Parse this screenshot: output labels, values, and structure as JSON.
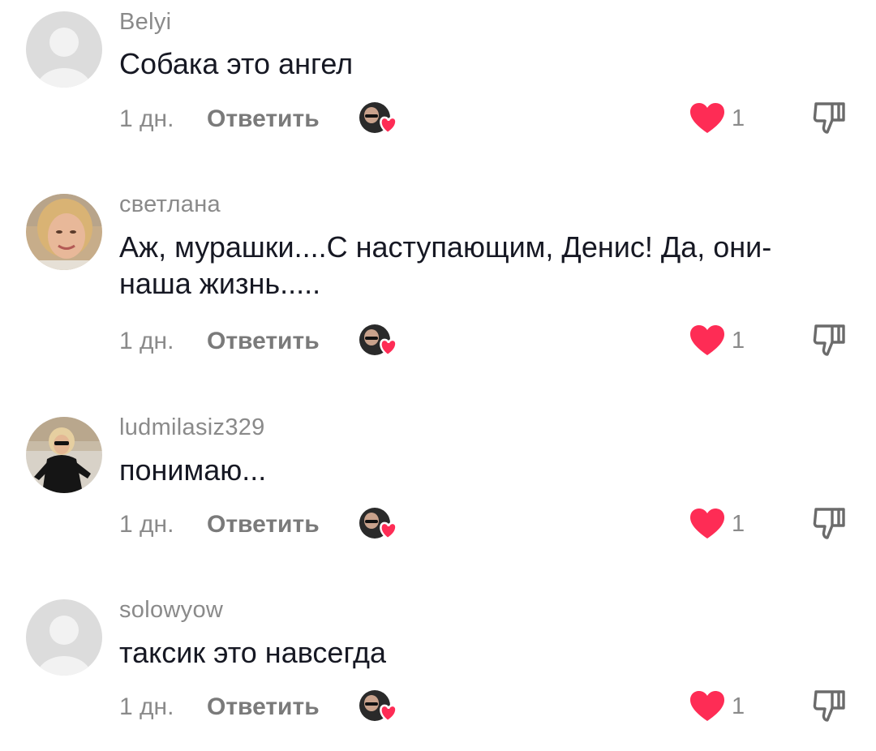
{
  "comments": [
    {
      "username": "Belyi",
      "text": "Собака это ангел",
      "time": "1 дн.",
      "reply_label": "Ответить",
      "likes": "1",
      "avatar": "default-avatar"
    },
    {
      "username": "светлана",
      "text": "Аж, мурашки....С наступающим, Денис! Да, они-\nнаша жизнь.....",
      "time": "1 дн.",
      "reply_label": "Ответить",
      "likes": "1",
      "avatar": "photo-woman-blonde"
    },
    {
      "username": "ludmilasiz329",
      "text": "понимаю...",
      "time": "1 дн.",
      "reply_label": "Ответить",
      "likes": "1",
      "avatar": "photo-woman-black-dress"
    },
    {
      "username": "solowyow",
      "text": "таксик это навсегда",
      "time": "1 дн.",
      "reply_label": "Ответить",
      "likes": "1",
      "avatar": "default-avatar"
    }
  ],
  "colors": {
    "like_red": "#fe2c55",
    "muted_text": "#8a8a8a",
    "main_text": "#161823",
    "default_avatar_bg": "#dcdcdc"
  },
  "icons": {
    "creator_like": "creator-liked-icon",
    "like": "heart-icon",
    "dislike": "thumbs-down-icon"
  }
}
